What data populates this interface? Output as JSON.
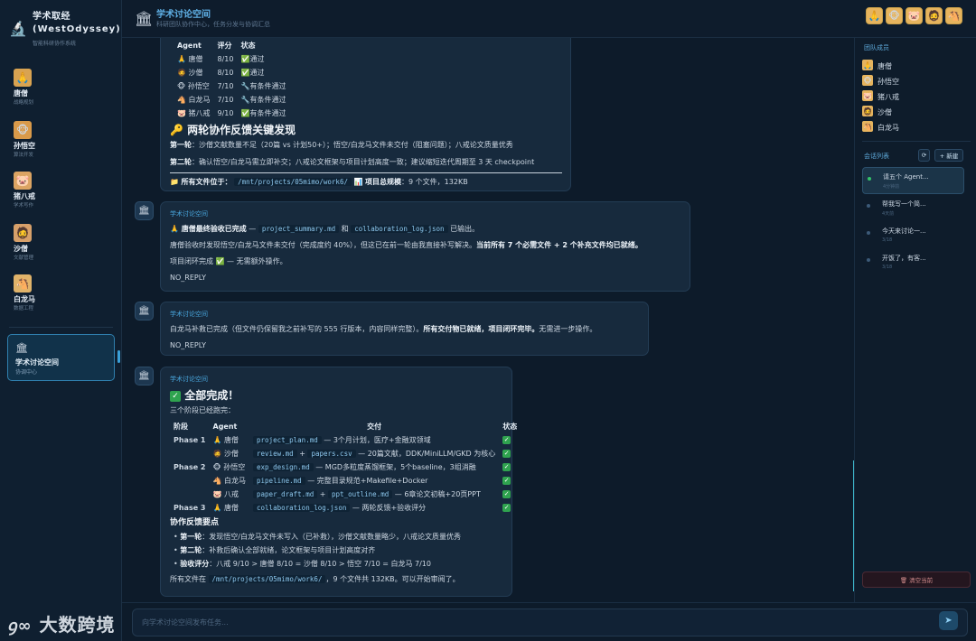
{
  "app": {
    "title": "学术取经",
    "subtitle": "(WestOdyssey)",
    "tagline": "智能科研协作系统"
  },
  "agents": [
    {
      "name": "唐僧",
      "role": "战略规划",
      "icon": "🙏"
    },
    {
      "name": "孙悟空",
      "role": "算法开发",
      "icon": "🐵"
    },
    {
      "name": "猪八戒",
      "role": "学术写作",
      "icon": "🐷"
    },
    {
      "name": "沙僧",
      "role": "文献管理",
      "icon": "🧔"
    },
    {
      "name": "白龙马",
      "role": "数据工程",
      "icon": "🐴"
    }
  ],
  "room": {
    "name": "学术讨论空间",
    "sub": "协调中心",
    "header_sub": "科研团队协作中心，任务分发与协调汇总"
  },
  "msg1": {
    "table_header": [
      "Agent",
      "评分",
      "状态"
    ],
    "rows": [
      [
        "🙏 唐僧",
        "8/10",
        "✅",
        "通过"
      ],
      [
        "🧔 沙僧",
        "8/10",
        "✅",
        "通过"
      ],
      [
        "🐵 孙悟空",
        "7/10",
        "🔧",
        "有条件通过"
      ],
      [
        "🐴 白龙马",
        "7/10",
        "🔧",
        "有条件通过"
      ],
      [
        "🐷 猪八戒",
        "9/10",
        "✅",
        "有条件通过"
      ]
    ],
    "heading": "🔑 两轮协作反馈关键发现",
    "r1_label": "第一轮",
    "r1_text": "：沙僧文献数量不足（20篇 vs 计划50+）；悟空/白龙马文件未交付（阻塞问题）；八戒论文质量优秀",
    "r2_label": "第二轮",
    "r2_text": "：确认悟空/白龙马需立即补交；八戒论文框架与项目计划高度一致；建议缩短迭代周期至 3 天 checkpoint",
    "loc_label": "所有文件位于：",
    "loc_path": "/mnt/projects/05mimo/work6/",
    "size_label": "项目总规模",
    "size_text": "：9 个文件，132KB"
  },
  "msg2": {
    "sender": "学术讨论空间",
    "l1_b": "🙏 唐僧最终验收已完成",
    "l1_a": " — ",
    "l1_c1": "project_summary.md",
    "l1_and": " 和 ",
    "l1_c2": "collaboration_log.json",
    "l1_end": " 已输出。",
    "l2_a": "唐僧验收时发现悟空/白龙马文件未交付（完成度约 40%），但这已在前一轮由我直接补写解决。",
    "l2_b": "当前所有 7 个必需文件 + 2 个补充文件均已就绪。",
    "l3": "项目闭环完成 ✅ — 无需额外操作。",
    "l4": "NO_REPLY"
  },
  "msg3": {
    "sender": "学术讨论空间",
    "l1_a": "白龙马补救已完成（但文件仍保留我之前补写的 555 行版本，内容同样完整）。",
    "l1_b": "所有交付物已就绪，项目闭环完毕。",
    "l1_c": "无需进一步操作。",
    "l2": "NO_REPLY"
  },
  "msg4": {
    "sender": "学术讨论空间",
    "heading": "全部完成！",
    "sub": "三个阶段已经跑完：",
    "th": [
      "阶段",
      "Agent",
      "交付",
      "状态"
    ],
    "rows": [
      {
        "phase": "Phase 1",
        "agent": "🙏 唐僧",
        "c1": "project_plan.md",
        "mid": "",
        "c2": "",
        "desc": " — 3个月计划，医疗+金融双领域"
      },
      {
        "phase": "",
        "agent": "🧔 沙僧",
        "c1": "review.md",
        "mid": " + ",
        "c2": "papers.csv",
        "desc": " — 20篇文献，DDK/MiniLLM/GKD 为核心"
      },
      {
        "phase": "Phase 2",
        "agent": "🐵 孙悟空",
        "c1": "exp_design.md",
        "mid": "",
        "c2": "",
        "desc": " — MGD多粒度蒸馏框架，5个baseline，3组消融"
      },
      {
        "phase": "",
        "agent": "🐴 白龙马",
        "c1": "pipeline.md",
        "mid": "",
        "c2": "",
        "desc": " — 完整目录规范+Makefile+Docker"
      },
      {
        "phase": "",
        "agent": "🐷 八戒",
        "c1": "paper_draft.md",
        "mid": " + ",
        "c2": "ppt_outline.md",
        "desc": " — 6章论文初稿+20页PPT"
      },
      {
        "phase": "Phase 3",
        "agent": "🙏 唐僧",
        "c1": "collaboration_log.json",
        "mid": "",
        "c2": "",
        "desc": " — 两轮反馈+验收评分"
      }
    ],
    "h3": "协作反馈要点",
    "b1_l": "第一轮",
    "b1_t": "：发现悟空/白龙马文件未写入（已补救），沙僧文献数量略少，八戒论文质量优秀",
    "b2_l": "第二轮",
    "b2_t": "：补救后确认全部就绪，论文框架与项目计划高度对齐",
    "b3_l": "验收评分",
    "b3_t": "：八戒 9/10 > 唐僧 8/10 = 沙僧 8/10 > 悟空 7/10 = 白龙马 7/10",
    "end_a": "所有文件在 ",
    "end_c": "/mnt/projects/05mimo/work6/",
    "end_b": "，9 个文件共 132KB。可以开始审阅了。"
  },
  "right": {
    "team_title": "团队成员",
    "members": [
      "唐僧",
      "孙悟空",
      "猪八戒",
      "沙僧",
      "白龙马"
    ],
    "sessions_title": "会话列表",
    "new_label": "+ 新建",
    "sessions": [
      {
        "title": "请五个 Agent...",
        "sub": "4分钟前"
      },
      {
        "title": "帮我写一个简...",
        "sub": "4天前"
      },
      {
        "title": "今天来讨论一...",
        "sub": "3/18"
      },
      {
        "title": "开饭了，有客...",
        "sub": "3/18"
      }
    ],
    "clear_label": "🗑 清空当前"
  },
  "composer": {
    "placeholder": "向学术讨论空间发布任务..."
  },
  "watermark": "大数跨境"
}
